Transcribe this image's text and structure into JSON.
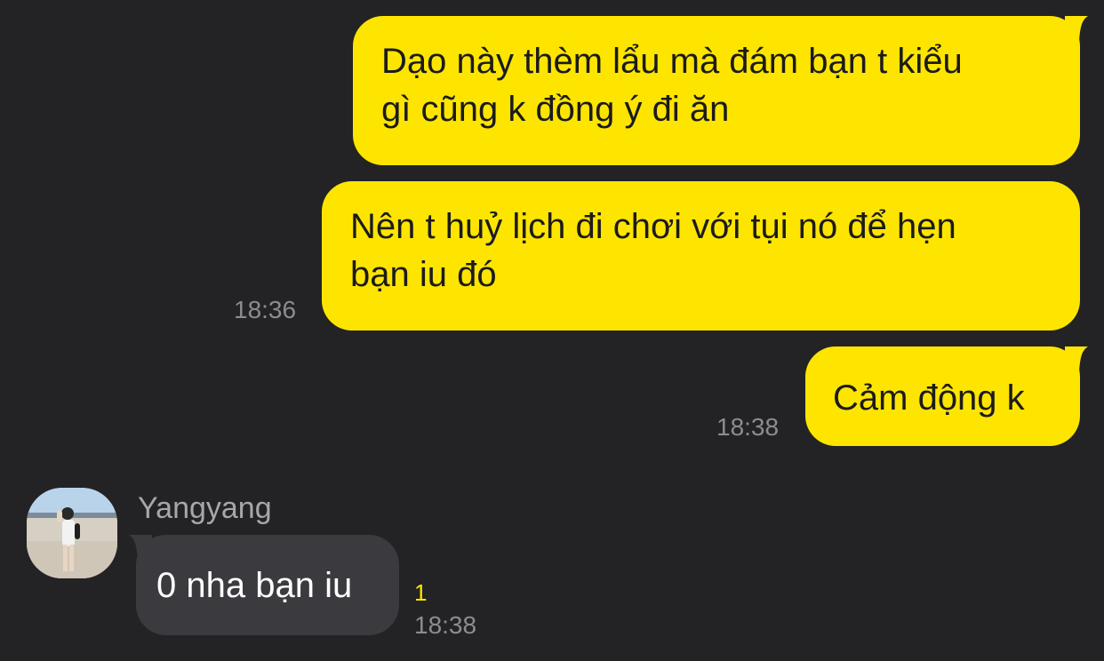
{
  "conversation": {
    "outgoing": [
      {
        "text": "Dạo này thèm lẩu mà đám bạn t kiểu\ngì cũng k đồng ý đi ăn"
      },
      {
        "text": "Nên t huỷ lịch đi chơi với tụi nó để hẹn\nbạn iu đó",
        "time": "18:36"
      },
      {
        "text": "Cảm động k",
        "time": "18:38"
      }
    ],
    "incoming": [
      {
        "sender": "Yangyang",
        "avatar_icon": "profile-photo-icon",
        "text": "0 nha bạn iu",
        "unread_count": "1",
        "time": "18:38"
      }
    ]
  },
  "colors": {
    "background": "#232325",
    "outgoing_bubble": "#fee500",
    "incoming_bubble": "#3b3b3f",
    "unread_count": "#fee500",
    "timestamp": "#8c8c90"
  }
}
